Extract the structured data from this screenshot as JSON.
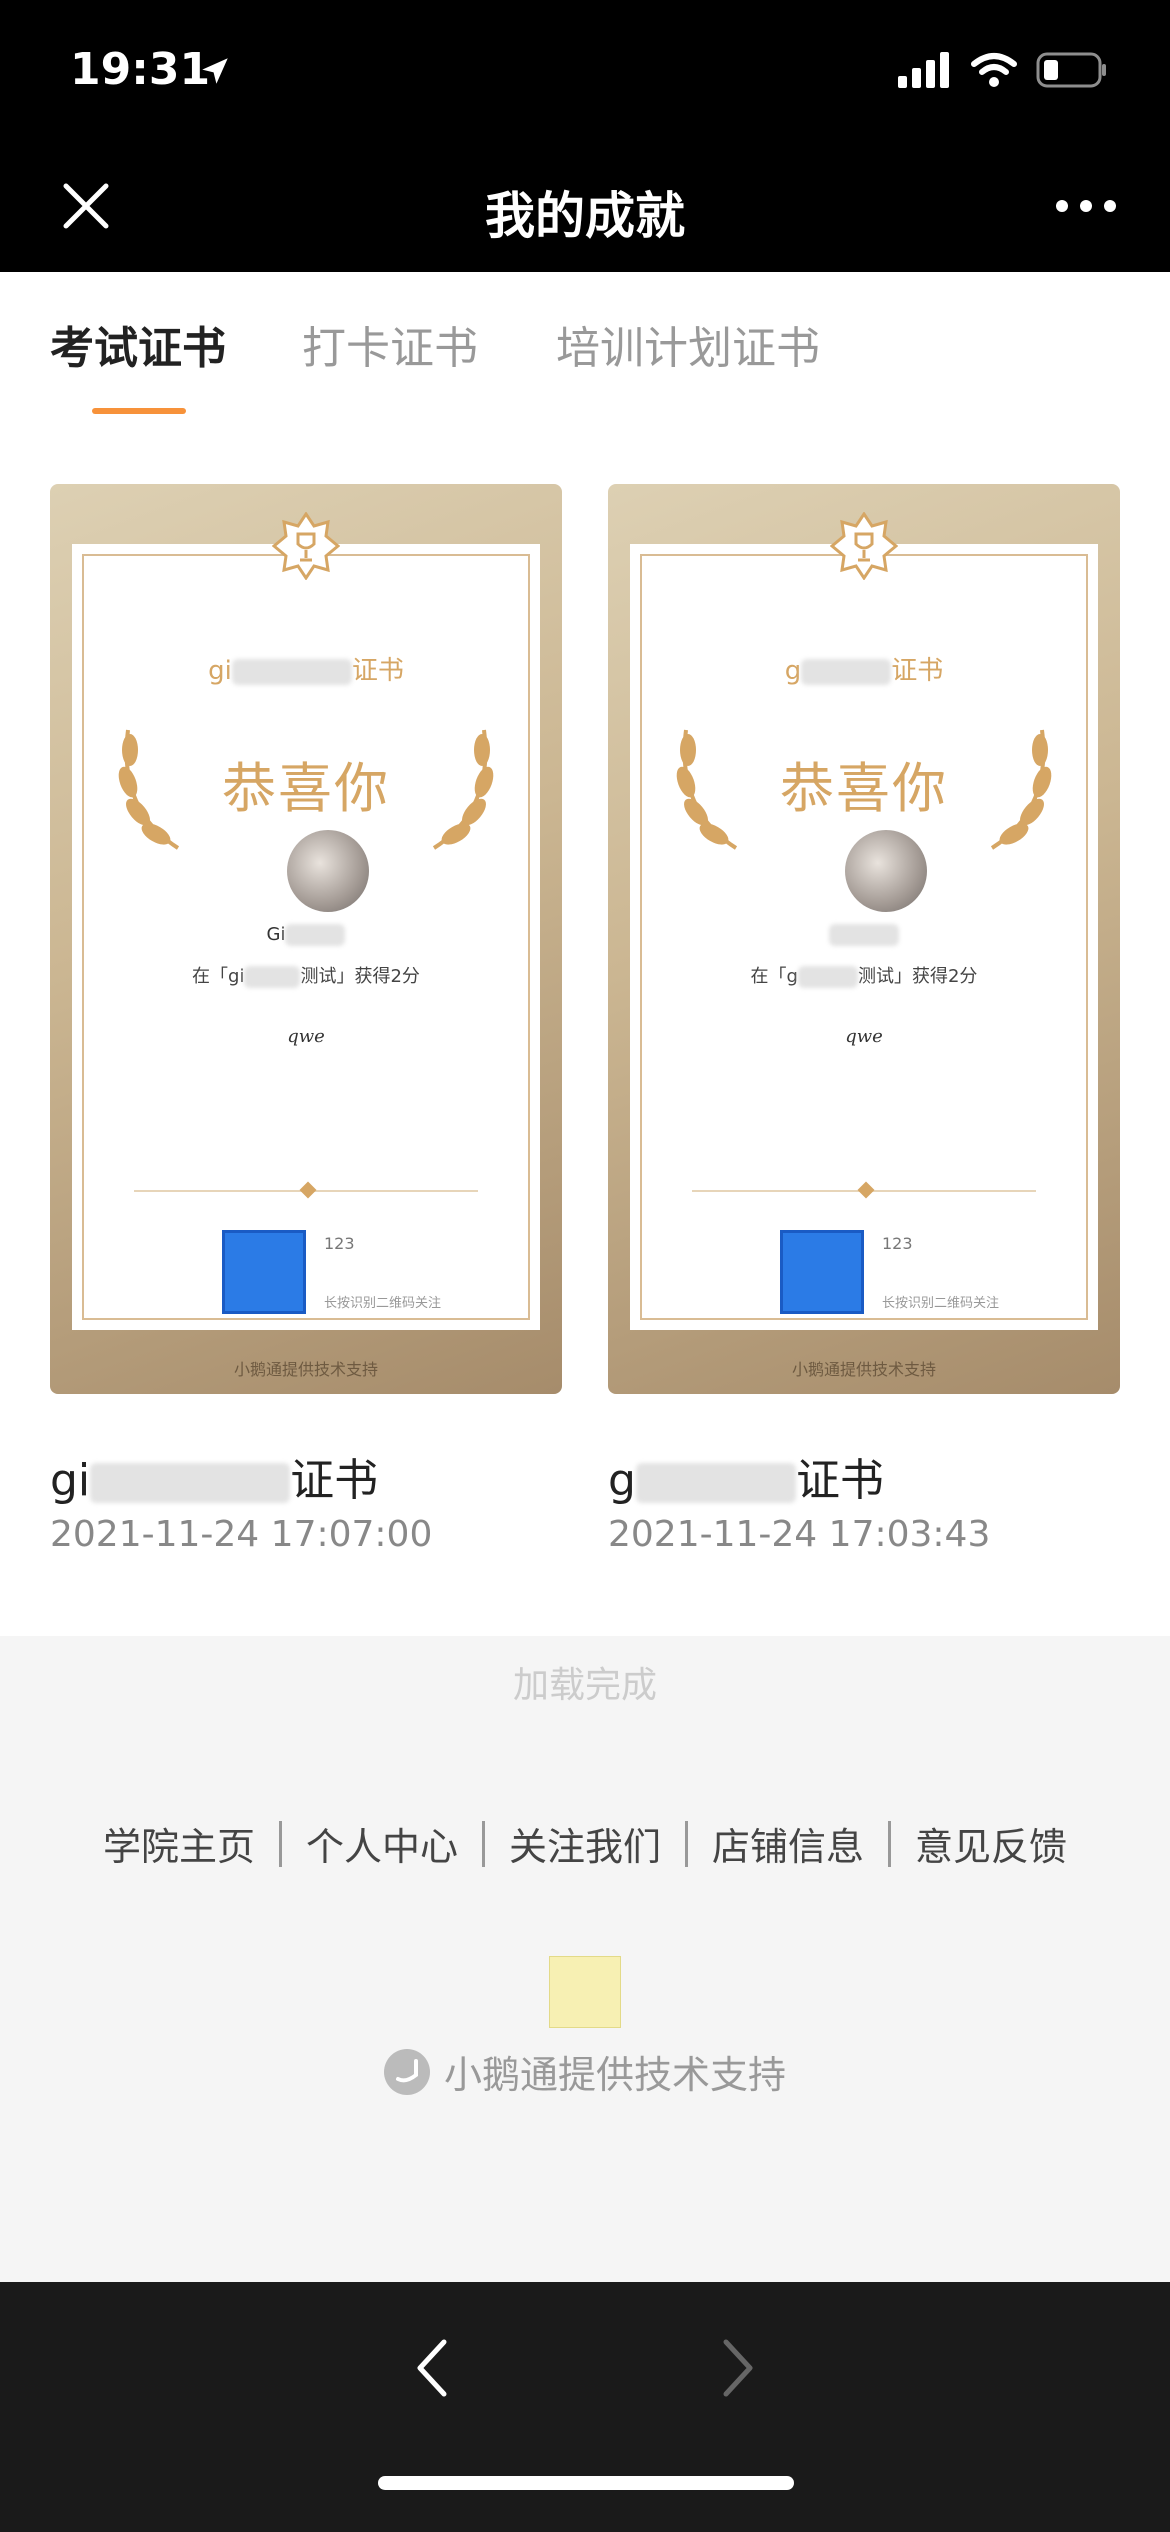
{
  "status": {
    "time": "19:31"
  },
  "nav": {
    "title": "我的成就"
  },
  "tabs": [
    {
      "label": "考试证书"
    },
    {
      "label": "打卡证书"
    },
    {
      "label": "培训计划证书"
    }
  ],
  "certificates": [
    {
      "cert_title_prefix": "gi",
      "cert_title_suffix": "证书",
      "congrats": "恭喜你",
      "recipient_prefix": "Gi",
      "line_prefix": "在「gi",
      "line_suffix": "测试」获得2分",
      "signature": "qwe",
      "qr_label": "123",
      "qr_hint": "长按识别二维码关注",
      "footer": "小鹅通提供技术支持",
      "name_prefix": "gi",
      "name_suffix": "证书",
      "time": "2021-11-24 17:07:00"
    },
    {
      "cert_title_prefix": "g",
      "cert_title_suffix": "证书",
      "congrats": "恭喜你",
      "recipient_prefix": "",
      "line_prefix": "在「g",
      "line_suffix": "测试」获得2分",
      "signature": "qwe",
      "qr_label": "123",
      "qr_hint": "长按识别二维码关注",
      "footer": "小鹅通提供技术支持",
      "name_prefix": "g",
      "name_suffix": "证书",
      "time": "2021-11-24 17:03:43"
    }
  ],
  "load_status": "加载完成",
  "footer_links": [
    "学院主页",
    "个人中心",
    "关注我们",
    "店铺信息",
    "意见反馈"
  ],
  "brand": "小鹅通提供技术支持",
  "colors": {
    "accent": "#F7923A",
    "gold": "#D6A664"
  }
}
